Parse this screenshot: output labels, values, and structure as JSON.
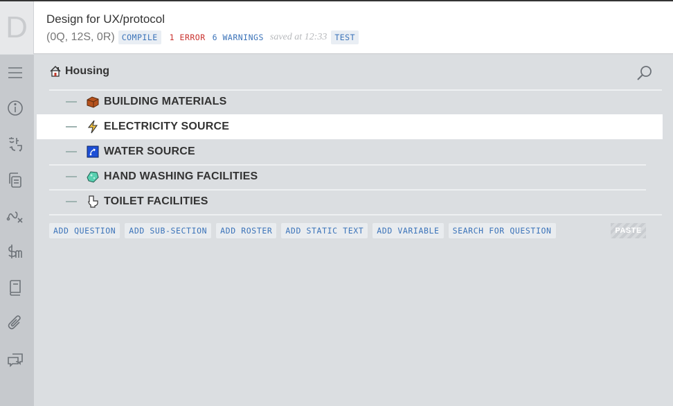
{
  "app": {
    "logo_letter": "D",
    "title": "Design for UX/protocol",
    "counts": "(0Q, 12S, 0R)",
    "compile_label": "COMPILE",
    "errors_label": "1 ERROR",
    "warnings_label": "6 WARNINGS",
    "saved_label": "saved at 12:33",
    "test_label": "TEST"
  },
  "sidebar": {
    "items": [
      {
        "name": "menu-icon"
      },
      {
        "name": "info-icon"
      },
      {
        "name": "translate-icon"
      },
      {
        "name": "copy-icon"
      },
      {
        "name": "macro-icon"
      },
      {
        "name": "money-icon"
      },
      {
        "name": "book-icon"
      },
      {
        "name": "attachment-icon"
      },
      {
        "name": "comments-icon"
      }
    ]
  },
  "section": {
    "title": "Housing",
    "icon": "house-icon",
    "subsections": [
      {
        "label": "BUILDING MATERIALS",
        "icon": "bricks-icon",
        "active": false
      },
      {
        "label": "ELECTRICITY SOURCE",
        "icon": "lightning-icon",
        "active": true
      },
      {
        "label": "WATER SOURCE",
        "icon": "water-icon",
        "active": false
      },
      {
        "label": "HAND WASHING FACILITIES",
        "icon": "soap-icon",
        "active": false
      },
      {
        "label": "TOILET FACILITIES",
        "icon": "toilet-icon",
        "active": false
      }
    ]
  },
  "actions": {
    "add_question": "ADD QUESTION",
    "add_sub_section": "ADD SUB-SECTION",
    "add_roster": "ADD ROSTER",
    "add_static_text": "ADD STATIC TEXT",
    "add_variable": "ADD VARIABLE",
    "search_for_question": "SEARCH FOR QUESTION",
    "paste": "PASTE"
  },
  "colors": {
    "accent": "#3b73b9",
    "error": "#c9302c",
    "sidebar_bg": "#c6c9cd",
    "main_bg": "#dbdee1"
  }
}
